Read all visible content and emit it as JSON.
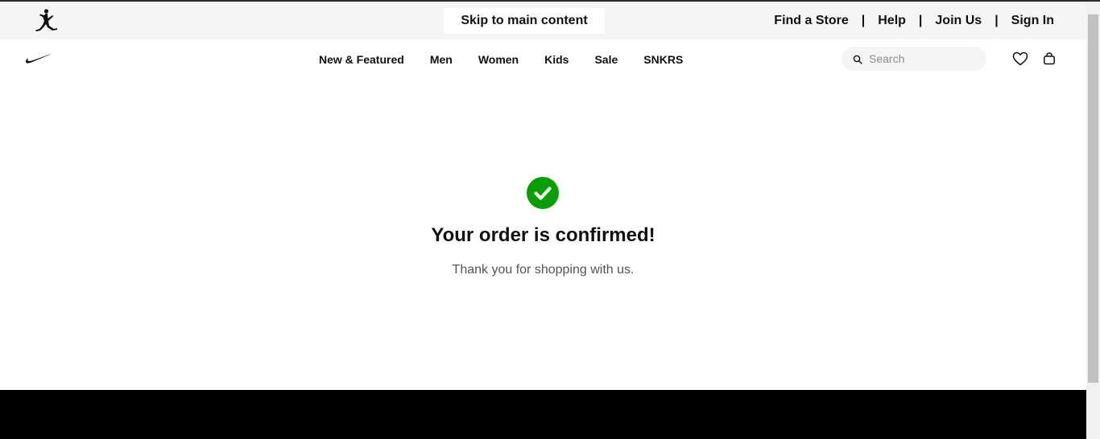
{
  "utility": {
    "skip_label": "Skip to main content",
    "links": [
      "Find a Store",
      "Help",
      "Join Us",
      "Sign In"
    ],
    "separator": "|"
  },
  "nav": {
    "links": [
      "New & Featured",
      "Men",
      "Women",
      "Kids",
      "Sale",
      "SNKRS"
    ],
    "search_placeholder": "Search"
  },
  "confirmation": {
    "title": "Your order is confirmed!",
    "subtitle": "Thank you for shopping with us.",
    "accent_color": "#05a000"
  },
  "icons": {
    "brand_jordan": "jumpman-logo-icon",
    "brand_nike": "swoosh-logo-icon",
    "search": "search-icon",
    "favorites": "heart-icon",
    "bag": "bag-icon",
    "success": "checkmark-circle-icon"
  }
}
